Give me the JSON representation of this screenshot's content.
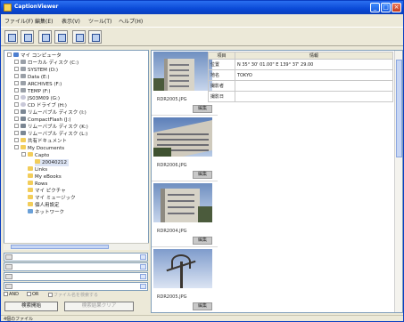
{
  "window": {
    "title": "CaptionViewer",
    "controls": [
      "_",
      "□",
      "×"
    ]
  },
  "menu": [
    "ファイル(F)",
    "編集(E)",
    "表示(V)",
    "ツール(T)",
    "ヘルプ(H)"
  ],
  "toolbar": {
    "buttons": [
      "open-folder-icon",
      "properties-icon",
      "tree-view-icon",
      "list-view-icon",
      "thumbnail-view-icon",
      "slideshow-icon"
    ]
  },
  "tree": {
    "items": [
      "マイ コンピュータ",
      "ローカル ディスク (C:)",
      "SYSTEM (D:)",
      "Data (E:)",
      "ARCHIVES (F:)",
      "TEMP (F:)",
      "JS03M09 (G:)",
      "CD ドライブ (H:)",
      "リムーバブル ディスク (I:)",
      "CompactFlash (J:)",
      "リムーバブル ディスク (K:)",
      "リムーバブル ディスク (L:)",
      "共有ドキュメント",
      "My Documents",
      "Capto",
      "20040212",
      "Links",
      "My eBooks",
      "Rows",
      "マイ ピクチャ",
      "マイ ミュージック",
      "個人用設定",
      "ネットワーク"
    ]
  },
  "search": {
    "options": [
      "AND",
      "OR",
      "ファイル名を検索する"
    ],
    "search_button": "検索開始",
    "clear_button": "検索結果クリア"
  },
  "status": "4個のファイル",
  "files": [
    {
      "name": "RDR2005.JPG",
      "edit": "編集"
    },
    {
      "name": "RDR2006.JPG",
      "edit": "編集"
    },
    {
      "name": "RDR2004.JPG",
      "edit": "編集"
    },
    {
      "name": "RDR2005.JPG",
      "edit": "編集"
    }
  ],
  "properties": {
    "headers": [
      "項目",
      "情報"
    ],
    "rows": [
      {
        "key": "位置",
        "value": "N 35° 30' 01.00\"  E 139° 37' 29.00"
      },
      {
        "key": "地名",
        "value": "TOKYO"
      },
      {
        "key": "撮影者",
        "value": ""
      },
      {
        "key": "撮影日",
        "value": ""
      }
    ]
  },
  "colors": {
    "titlebar": "#0a49d6",
    "window_bg": "#ece9d8",
    "folder": "#f2cd5a"
  }
}
